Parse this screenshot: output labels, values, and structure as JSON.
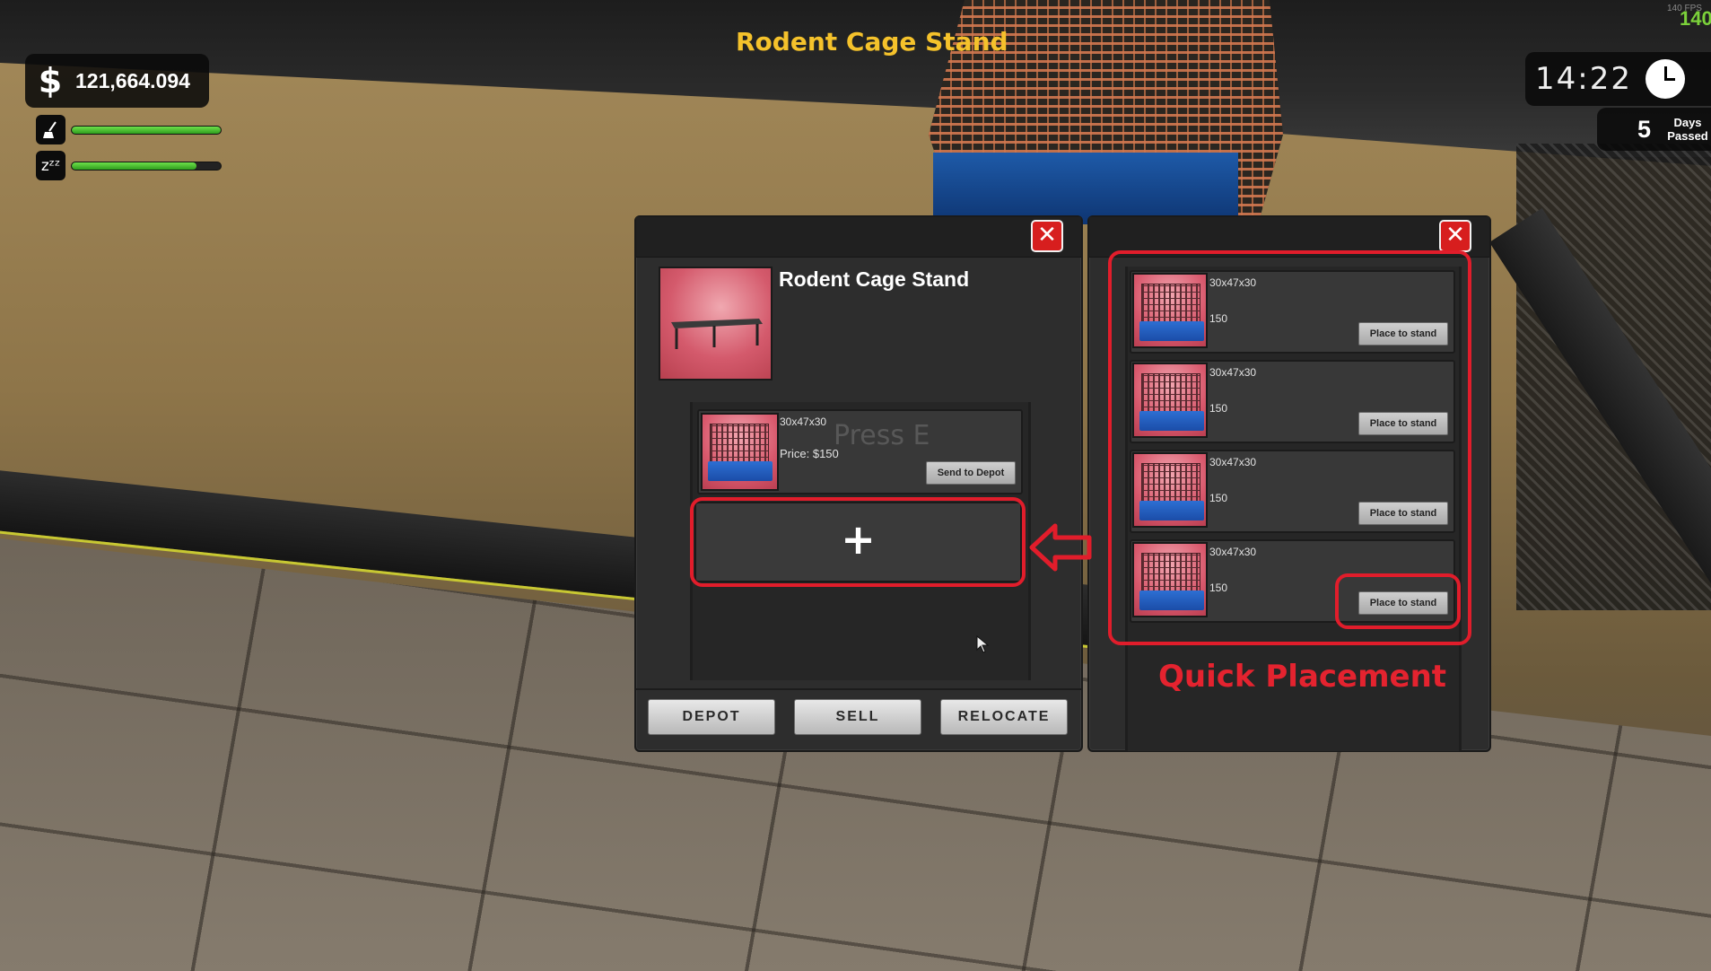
{
  "hud": {
    "world_title": "Rodent Cage Stand",
    "money_symbol": "$",
    "money": "121,664.094",
    "cleanliness_icon": "broom-icon",
    "cleanliness_level": 1.0,
    "sleep_icon": "zzz-icon",
    "sleep_icon_text": "zᶻᶻ",
    "sleep_level": 0.84,
    "time": "14:22",
    "days_passed": "5",
    "days_label_line1": "Days",
    "days_label_line2": "Passed",
    "fps_small": "140 FPS",
    "fps_big": "140"
  },
  "left_panel": {
    "close_symbol": "✕",
    "item_name": "Rodent Cage Stand",
    "slots": [
      {
        "dimensions": "30x47x30",
        "price": "Price: $150",
        "button": "Send to Depot"
      }
    ],
    "press_hint": "Press E",
    "add_symbol": "+",
    "buttons": {
      "depot": "DEPOT",
      "sell": "SELL",
      "relocate": "RELOCATE"
    }
  },
  "right_panel": {
    "close_symbol": "✕",
    "items": [
      {
        "dimensions": "30x47x30",
        "price": "150",
        "button": "Place to stand"
      },
      {
        "dimensions": "30x47x30",
        "price": "150",
        "button": "Place to stand"
      },
      {
        "dimensions": "30x47x30",
        "price": "150",
        "button": "Place to stand"
      },
      {
        "dimensions": "30x47x30",
        "price": "150",
        "button": "Place to stand"
      }
    ],
    "annotation": "Quick Placement"
  },
  "colors": {
    "accent_yellow": "#f5c22b",
    "annotation_red": "#e11d2b",
    "close_red": "#d71e1e",
    "bar_green": "#4fc234"
  }
}
